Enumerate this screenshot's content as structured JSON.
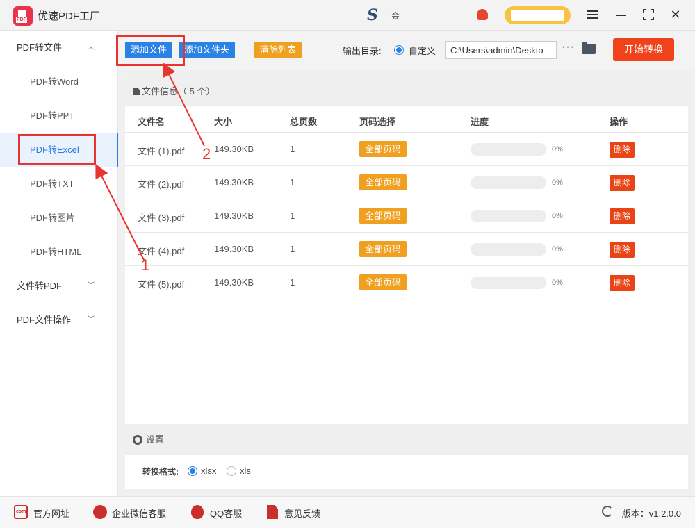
{
  "app": {
    "title": "优速PDF工厂",
    "brand_text": "S",
    "brand_label": "会"
  },
  "sidebar": {
    "groups": [
      {
        "label": "PDF转文件",
        "chevron": "^"
      },
      {
        "label": "文件转PDF",
        "chevron": "⌄"
      },
      {
        "label": "PDF文件操作",
        "chevron": "⌄"
      }
    ],
    "items": [
      {
        "label": "PDF转Word"
      },
      {
        "label": "PDF转PPT"
      },
      {
        "label": "PDF转Excel",
        "active": true
      },
      {
        "label": "PDF转TXT"
      },
      {
        "label": "PDF转图片"
      },
      {
        "label": "PDF转HTML"
      }
    ]
  },
  "toolbar": {
    "add_file": "添加文件",
    "add_folder": "添加文件夹",
    "clear_list": "清除列表",
    "output_label": "输出目录:",
    "output_option": "自定义",
    "output_path": "C:\\Users\\admin\\Deskto",
    "more": "···",
    "start": "开始转换"
  },
  "file_panel": {
    "title": "文件信息（ 5 个）",
    "columns": [
      "文件名",
      "大小",
      "总页数",
      "页码选择",
      "进度",
      "操作"
    ],
    "rows": [
      {
        "name": "文件 (1).pdf",
        "size": "149.30KB",
        "pages": "1",
        "page_select": "全部页码",
        "progress": 0,
        "progress_text": "0%",
        "action": "删除"
      },
      {
        "name": "文件 (2).pdf",
        "size": "149.30KB",
        "pages": "1",
        "page_select": "全部页码",
        "progress": 0,
        "progress_text": "0%",
        "action": "删除"
      },
      {
        "name": "文件 (3).pdf",
        "size": "149.30KB",
        "pages": "1",
        "page_select": "全部页码",
        "progress": 0,
        "progress_text": "0%",
        "action": "删除"
      },
      {
        "name": "文件 (4).pdf",
        "size": "149.30KB",
        "pages": "1",
        "page_select": "全部页码",
        "progress": 0,
        "progress_text": "0%",
        "action": "删除"
      },
      {
        "name": "文件 (5).pdf",
        "size": "149.30KB",
        "pages": "1",
        "page_select": "全部页码",
        "progress": 0,
        "progress_text": "0%",
        "action": "删除"
      }
    ]
  },
  "settings": {
    "title": "设置",
    "format_label": "转换格式:",
    "formats": [
      {
        "label": "xlsx",
        "checked": true
      },
      {
        "label": "xls",
        "checked": false
      }
    ]
  },
  "footer": {
    "links": [
      "官方网址",
      "企业微信客服",
      "QQ客服",
      "意见反馈"
    ],
    "version": "版本：v1.2.0.0"
  },
  "annotations": {
    "label_1": "1",
    "label_2": "2"
  },
  "colors": {
    "accent": "#2a82e4",
    "orange": "#f0a020",
    "danger": "#e94416",
    "annotation": "#e8342e"
  }
}
